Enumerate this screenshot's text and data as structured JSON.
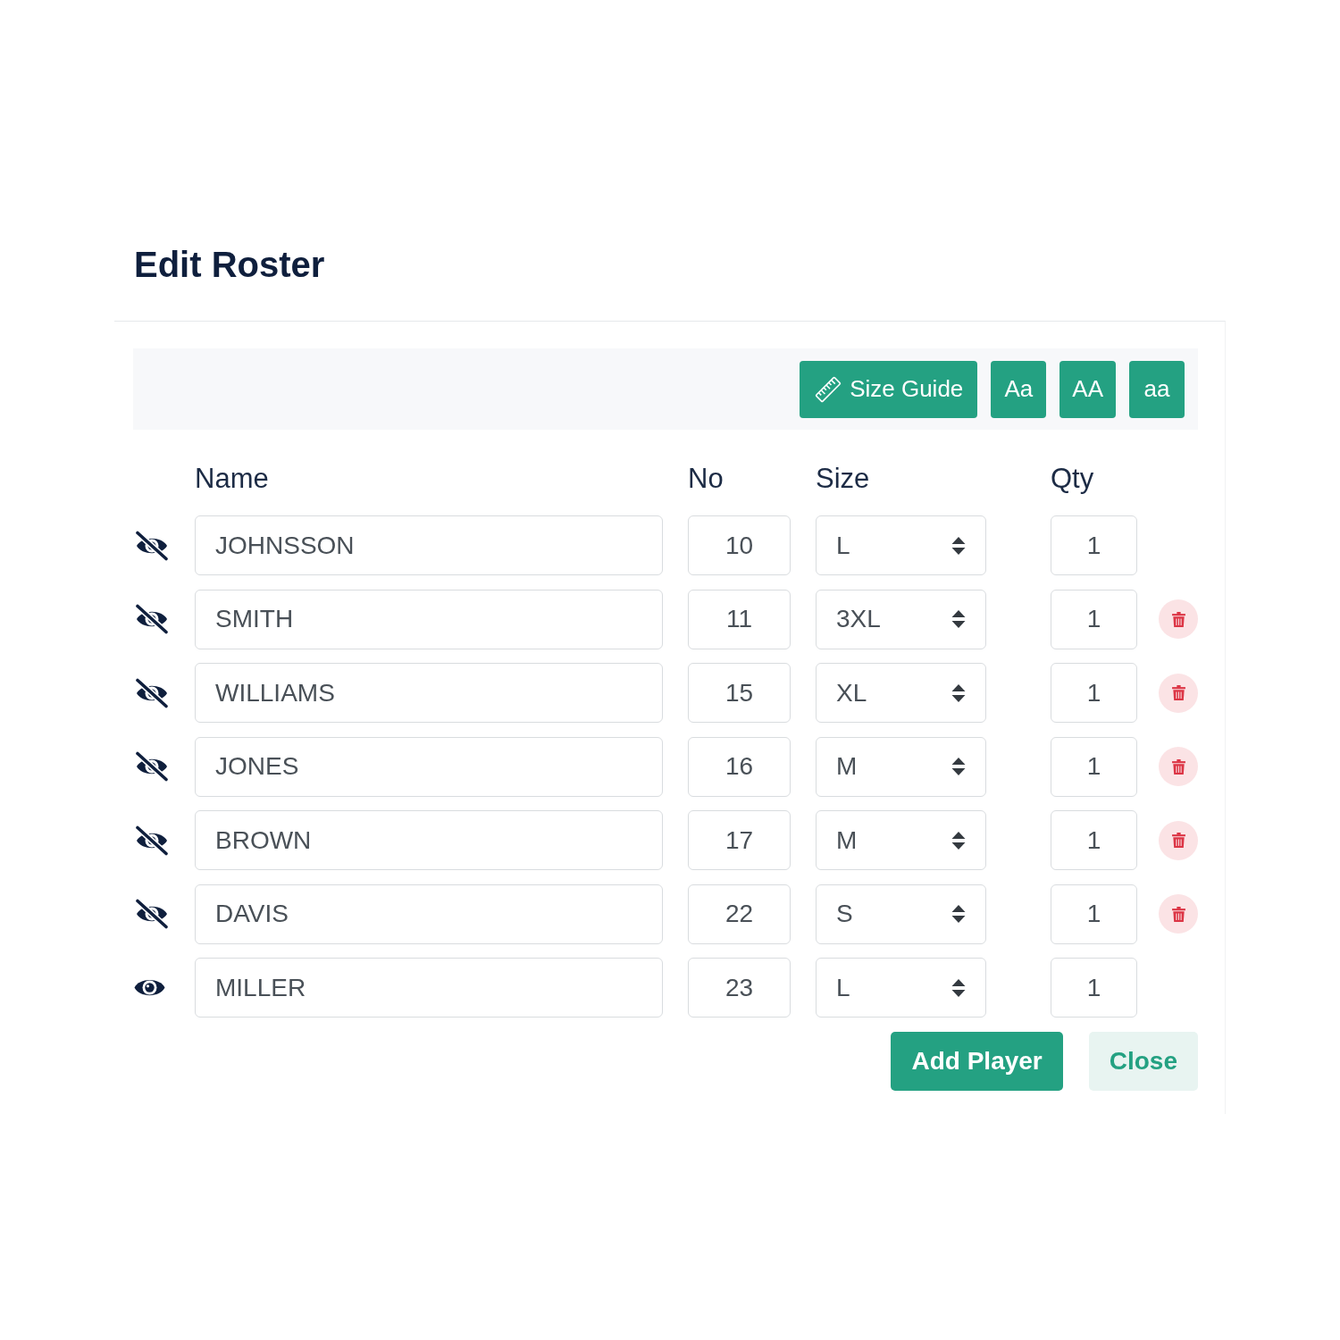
{
  "dialog": {
    "title": "Edit Roster"
  },
  "toolbar": {
    "buttons": [
      {
        "kind": "size_guide",
        "label": "Size Guide"
      },
      {
        "kind": "case",
        "label": "Aa"
      },
      {
        "kind": "case",
        "label": "AA"
      },
      {
        "kind": "case",
        "label": "aa"
      }
    ]
  },
  "table": {
    "columns": [
      "Name",
      "No",
      "Size",
      "Qty"
    ],
    "rows": [
      {
        "visible": false,
        "name": "JOHNSSON",
        "number": "10",
        "size": "L",
        "qty": "1",
        "removable": false
      },
      {
        "visible": false,
        "name": "SMITH",
        "number": "11",
        "size": "3XL",
        "qty": "1",
        "removable": true
      },
      {
        "visible": false,
        "name": "WILLIAMS",
        "number": "15",
        "size": "XL",
        "qty": "1",
        "removable": true
      },
      {
        "visible": false,
        "name": "JONES",
        "number": "16",
        "size": "M",
        "qty": "1",
        "removable": true
      },
      {
        "visible": false,
        "name": "BROWN",
        "number": "17",
        "size": "M",
        "qty": "1",
        "removable": true
      },
      {
        "visible": false,
        "name": "DAVIS",
        "number": "22",
        "size": "S",
        "qty": "1",
        "removable": true
      },
      {
        "visible": true,
        "name": "MILLER",
        "number": "23",
        "size": "L",
        "qty": "1",
        "removable": false
      }
    ]
  },
  "footer": {
    "buttons": [
      {
        "kind": "primary",
        "label": "Add Player"
      },
      {
        "kind": "secondary",
        "label": "Close"
      }
    ]
  }
}
